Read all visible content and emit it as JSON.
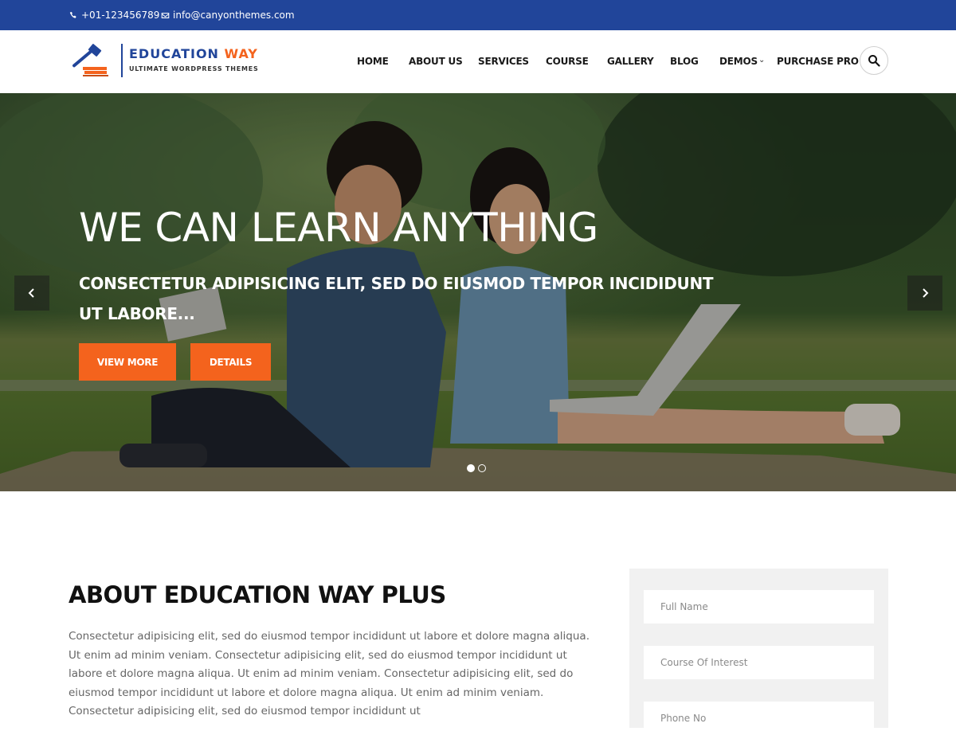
{
  "topbar": {
    "phone": "+01-123456789",
    "email": "info@canyonthemes.com"
  },
  "logo": {
    "title_main": "EDUCATION",
    "title_accent": " WAY",
    "subtitle": "ULTIMATE WORDPRESS THEMES"
  },
  "nav": {
    "items": [
      "HOME",
      "ABOUT US",
      "SERVICES",
      "COURSE",
      "GALLERY",
      "BLOG",
      "DEMOS",
      "PURCHASE PRO"
    ],
    "demos_has_dropdown": true
  },
  "hero": {
    "title": "WE CAN LEARN ANYTHING",
    "subtitle": "CONSECTETUR ADIPISICING ELIT, SED DO EIUSMOD TEMPOR INCIDIDUNT UT LABORE...",
    "btn_view_more": "VIEW MORE",
    "btn_details": "DETAILS",
    "slide_count": 2,
    "active_slide": 1
  },
  "about": {
    "title": "ABOUT EDUCATION WAY PLUS",
    "text": "Consectetur adipisicing elit, sed do eiusmod tempor incididunt ut labore et dolore magna aliqua. Ut enim ad minim veniam. Consectetur adipisicing elit, sed do eiusmod tempor incididunt ut labore et dolore magna aliqua. Ut enim ad minim veniam. Consectetur adipisicing elit, sed do eiusmod tempor incididunt ut labore et dolore magna aliqua. Ut enim ad minim veniam. Consectetur adipisicing elit, sed do eiusmod tempor incididunt ut"
  },
  "form": {
    "full_name_placeholder": "Full Name",
    "course_placeholder": "Course Of Interest",
    "phone_placeholder": "Phone No"
  },
  "colors": {
    "brand_blue": "#21459a",
    "accent_orange": "#f4631d"
  },
  "icons": {
    "phone": "phone-icon",
    "email": "envelope-icon",
    "search": "search-icon",
    "prev": "chevron-left-icon",
    "next": "chevron-right-icon",
    "dropdown": "chevron-down-icon"
  }
}
